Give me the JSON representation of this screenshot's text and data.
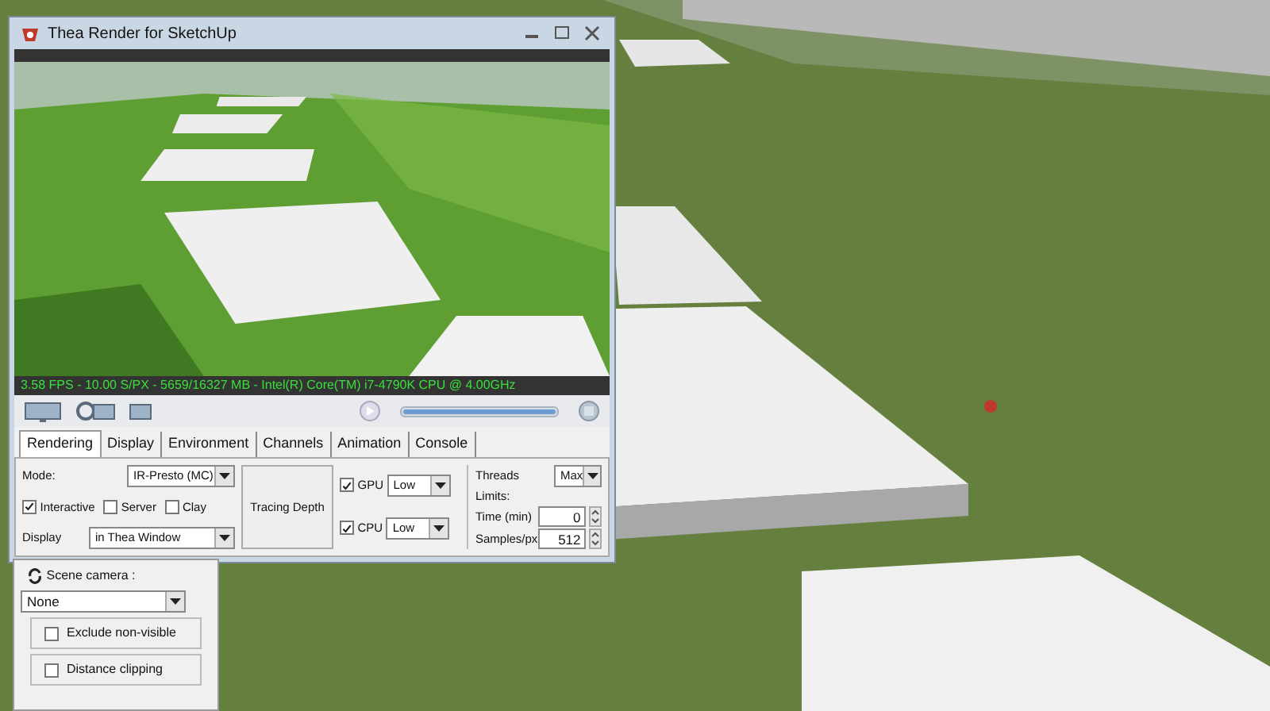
{
  "window": {
    "title": "Thea Render for SketchUp"
  },
  "render_status": "3.58 FPS - 10.00 S/PX - 5659/16327 MB - Intel(R) Core(TM) i7-4790K CPU @ 4.00GHz",
  "progress": {
    "level": 1
  },
  "tabs": [
    {
      "label": "Rendering",
      "selected": true
    },
    {
      "label": "Display",
      "selected": false
    },
    {
      "label": "Environment",
      "selected": false
    },
    {
      "label": "Channels",
      "selected": false
    },
    {
      "label": "Animation",
      "selected": false
    },
    {
      "label": "Console",
      "selected": false
    }
  ],
  "rendering": {
    "mode": {
      "label": "Mode:",
      "value": "IR-Presto (MC)"
    },
    "options": [
      {
        "label": "Interactive",
        "checked": true
      },
      {
        "label": "Server",
        "checked": false
      },
      {
        "label": "Clay",
        "checked": false
      }
    ],
    "display": {
      "label": "Display",
      "value": "in Thea Window"
    },
    "tracing_depth": "Tracing Depth",
    "devices": [
      {
        "label": "GPU",
        "checked": true,
        "value": "Low"
      },
      {
        "label": "CPU",
        "checked": true,
        "value": "Low"
      }
    ],
    "threads": {
      "label": "Threads",
      "value": "Max"
    },
    "limits_label": "Limits:",
    "limits": [
      {
        "label": "Time (min)",
        "value": "0"
      },
      {
        "label": "Samples/px",
        "value": "512"
      }
    ]
  },
  "scene_panel": {
    "camera_label": "Scene camera :",
    "camera_value": "None",
    "options": [
      {
        "label": "Exclude non-visible",
        "checked": false
      },
      {
        "label": "Distance clipping",
        "checked": false
      }
    ]
  }
}
